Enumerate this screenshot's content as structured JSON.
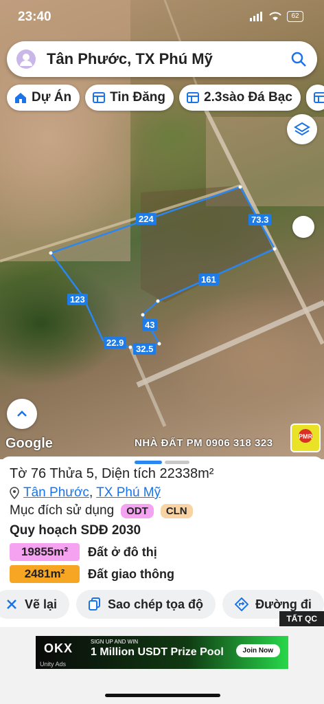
{
  "status": {
    "time": "23:40",
    "battery": "62"
  },
  "search": {
    "text": "Tân Phước, TX Phú Mỹ"
  },
  "chips": [
    {
      "icon": "home-icon",
      "label": "Dự Án"
    },
    {
      "icon": "table-icon",
      "label": "Tin Đăng"
    },
    {
      "icon": "table-icon",
      "label": "2.3sào Đá Bạc"
    }
  ],
  "map": {
    "measurements": {
      "top": "224",
      "right": "73.3",
      "bottom": "161",
      "left": "123",
      "s1": "43",
      "s2": "22.9",
      "s3": "32.5"
    },
    "google_label": "Google",
    "watermark": "NHÀ ĐẤT PM 0906 318 323",
    "logo_text": "PMR"
  },
  "parcel": {
    "title": "Tờ 76 Thửa 5, Diện tích 22338m²",
    "location_ward": "Tân Phước",
    "location_sep": ",",
    "location_town": "TX Phú Mỹ",
    "purpose_label": "Mục đích sử dụng",
    "purpose_tags": [
      "ODT",
      "CLN"
    ],
    "plan_title": "Quy hoạch SDĐ 2030",
    "zones": [
      {
        "area": "19855m²",
        "label": "Đất ở đô thị",
        "color": "#f5a3f0"
      },
      {
        "area": "2481m²",
        "label": "Đất giao thông",
        "color": "#f6a623"
      }
    ]
  },
  "actions": [
    {
      "icon": "reset-icon",
      "label": "Vẽ lại"
    },
    {
      "icon": "copy-icon",
      "label": "Sao chép tọa độ"
    },
    {
      "icon": "directions-icon",
      "label": "Đường đi"
    }
  ],
  "ad": {
    "close_label": "TẤT QC",
    "brand": "OKX",
    "small": "SIGN UP AND WIN",
    "headline": "1 Million USDT Prize Pool",
    "cta": "Join Now",
    "network": "Unity Ads"
  },
  "colors": {
    "accent": "#1a73e8",
    "boundary": "#1e7ce8",
    "odt_tag": "#f3a3f0",
    "cln_tag": "#f8d3a3"
  }
}
